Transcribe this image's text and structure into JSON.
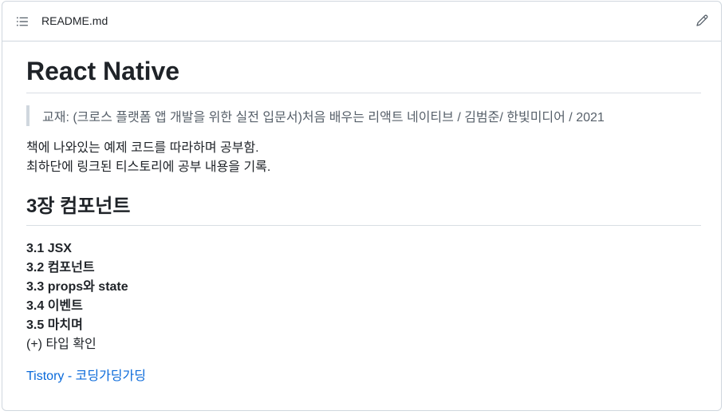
{
  "header": {
    "file_name": "README.md",
    "list_icon": "list-unordered-icon",
    "edit_icon": "pencil-icon"
  },
  "readme": {
    "title": "React Native",
    "blockquote": "교재: (크로스 플랫폼 앱 개발을 위한 실전 입문서)처음 배우는 리액트 네이티브 / 김범준/ 한빛미디어 / 2021",
    "paragraph_lines": [
      "책에 나와있는 예제 코드를 따라하며 공부함.",
      "최하단에 링크된 티스토리에 공부 내용을 기록."
    ],
    "section_heading": "3장 컴포넌트",
    "toc": [
      {
        "text": "3.1 JSX",
        "bold": true
      },
      {
        "text": "3.2 컴포넌트",
        "bold": true
      },
      {
        "text": "3.3 props와 state",
        "bold": true
      },
      {
        "text": "3.4 이벤트",
        "bold": true
      },
      {
        "text": "3.5 마치며",
        "bold": true
      },
      {
        "text": "(+) 타입 확인",
        "bold": false
      }
    ],
    "link_text": "Tistory - 코딩가딩가딩"
  },
  "colors": {
    "link": "#0969da",
    "border": "#d0d7de",
    "muted_text": "#57606a",
    "text": "#1f2328"
  }
}
